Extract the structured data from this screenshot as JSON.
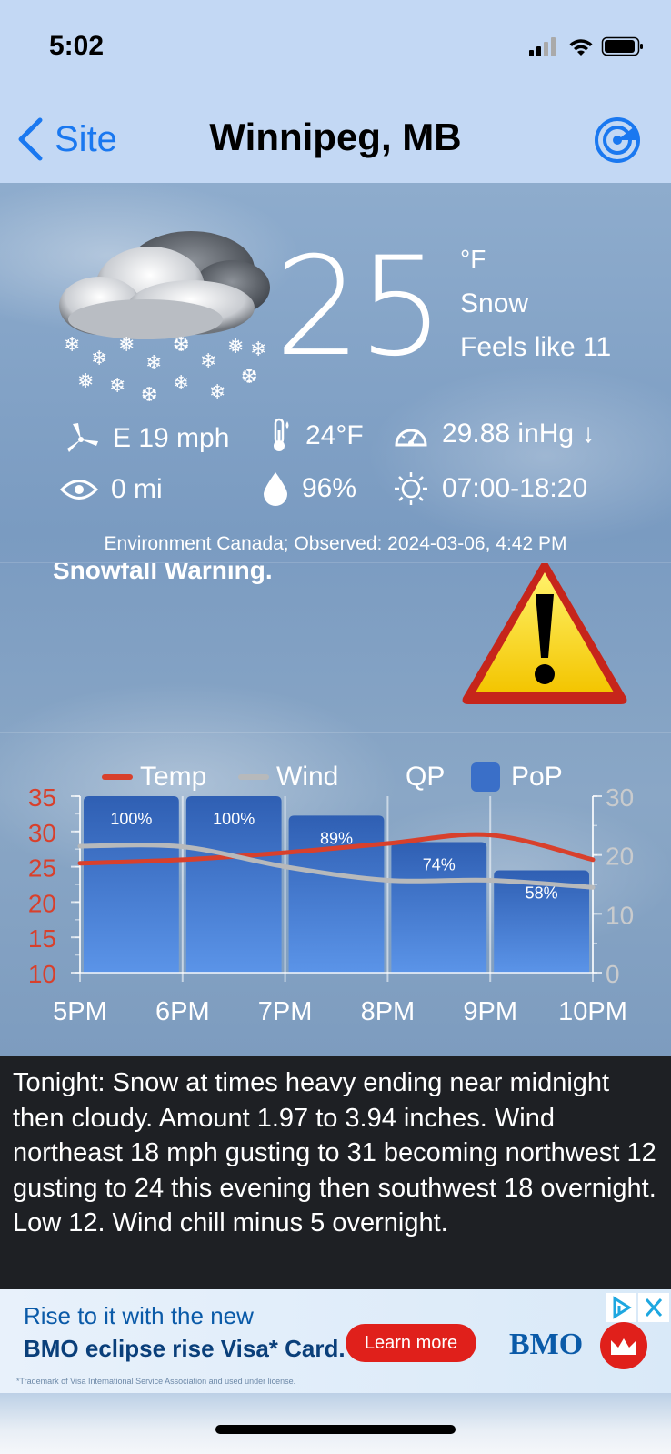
{
  "status_bar": {
    "time": "5:02"
  },
  "nav": {
    "back_label": "Site",
    "title": "Winnipeg, MB"
  },
  "current": {
    "temperature": "25",
    "unit": "°F",
    "condition": "Snow",
    "feels_like": "Feels like 11"
  },
  "details": {
    "wind": "E 19 mph",
    "dewpoint": "24°F",
    "pressure": "29.88 inHg ↓",
    "visibility": "0 mi",
    "humidity": "96%",
    "sun": "07:00-18:20"
  },
  "observed": "Environment Canada; Observed: 2024-03-06, 4:42 PM",
  "warning": {
    "text": "Snowfall Warning."
  },
  "legend": {
    "temp": "Temp",
    "wind": "Wind",
    "qp": "QP",
    "pop": "PoP"
  },
  "colors": {
    "temp": "#d8402c",
    "wind": "#b7b9bb",
    "pop": "#3a6fc8",
    "link": "#1a78f0"
  },
  "chart_data": {
    "type": "bar",
    "categories": [
      "5PM",
      "6PM",
      "7PM",
      "8PM",
      "9PM",
      "10PM"
    ],
    "pop": {
      "name": "PoP",
      "values": [
        100,
        100,
        89,
        74,
        58
      ],
      "labels": [
        "100%",
        "100%",
        "89%",
        "74%",
        "58%"
      ]
    },
    "series": [
      {
        "name": "Temp",
        "axis": "left",
        "x": [
          0,
          1,
          2,
          3,
          4,
          5
        ],
        "values": [
          25.5,
          26.0,
          27.0,
          28.3,
          29.5,
          26.0
        ]
      },
      {
        "name": "Wind",
        "axis": "right",
        "x": [
          0,
          1,
          2,
          3,
          4,
          5
        ],
        "values": [
          21.5,
          21.4,
          18.0,
          15.7,
          15.7,
          14.5
        ]
      }
    ],
    "y_left": {
      "ylim": [
        10,
        35
      ],
      "ticks": [
        "10",
        "15",
        "20",
        "25",
        "30",
        "35"
      ]
    },
    "y_right": {
      "ylim": [
        0,
        30
      ],
      "ticks": [
        "0",
        "10",
        "20",
        "30"
      ]
    }
  },
  "forecast": "Tonight:  Snow at times heavy ending near midnight then cloudy. Amount 1.97 to 3.94 inches. Wind northeast 18 mph gusting to 31 becoming northwest 12 gusting to 24 this evening then southwest 18 overnight. Low 12. Wind chill minus 5 overnight.",
  "ad": {
    "line1": "Rise to it with the new",
    "line2": "BMO eclipse rise Visa* Card.",
    "button": "Learn more",
    "brand": "BMO",
    "fine_print": "*Trademark of Visa International Service Association and used under license."
  }
}
